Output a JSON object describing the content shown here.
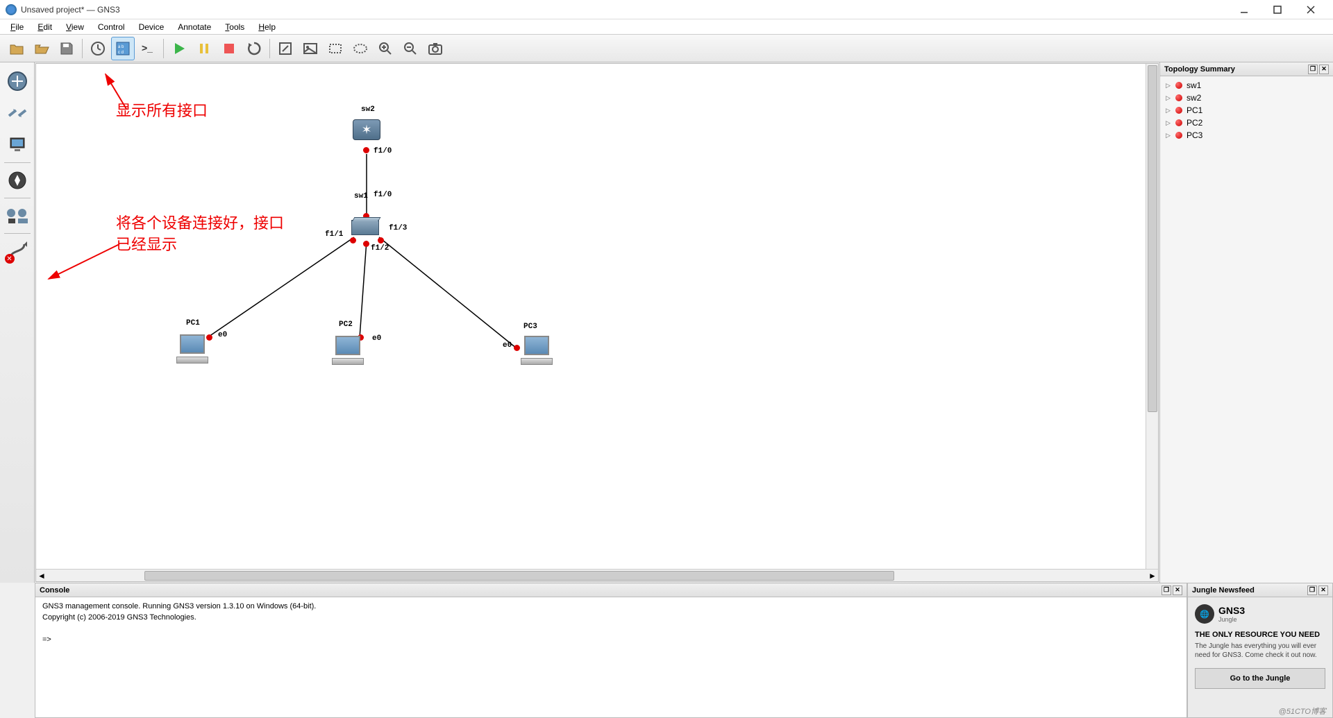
{
  "window": {
    "title": "Unsaved project* — GNS3"
  },
  "menu": {
    "file": "File",
    "edit": "Edit",
    "view": "View",
    "control": "Control",
    "device": "Device",
    "annotate": "Annotate",
    "tools": "Tools",
    "help": "Help"
  },
  "annotations": {
    "show_interfaces": "显示所有接口",
    "connect_devices": "将各个设备连接好，接口\n已经显示"
  },
  "topology": {
    "panel_title": "Topology Summary",
    "items": [
      {
        "name": "sw1"
      },
      {
        "name": "sw2"
      },
      {
        "name": "PC1"
      },
      {
        "name": "PC2"
      },
      {
        "name": "PC3"
      }
    ]
  },
  "canvas": {
    "nodes": {
      "sw2": {
        "label": "sw2"
      },
      "sw1": {
        "label": "sw1"
      },
      "pc1": {
        "label": "PC1"
      },
      "pc2": {
        "label": "PC2"
      },
      "pc3": {
        "label": "PC3"
      }
    },
    "ports": {
      "sw2_f10": "f1/0",
      "sw1_f10": "f1/0",
      "sw1_f11": "f1/1",
      "sw1_f12": "f1/2",
      "sw1_f13": "f1/3",
      "pc1_e0": "e0",
      "pc2_e0": "e0",
      "pc3_e0": "e0"
    }
  },
  "console": {
    "panel_title": "Console",
    "line1": "GNS3 management console. Running GNS3 version 1.3.10 on Windows (64-bit).",
    "line2": "Copyright (c) 2006-2019 GNS3 Technologies.",
    "prompt": "=>"
  },
  "newsfeed": {
    "panel_title": "Jungle Newsfeed",
    "brand": "GNS3",
    "brand_sub": "Jungle",
    "headline": "THE ONLY RESOURCE YOU NEED",
    "desc": "The Jungle has everything you will ever need for GNS3. Come check it out now.",
    "button": "Go to the Jungle"
  },
  "watermark": "@51CTO博客"
}
